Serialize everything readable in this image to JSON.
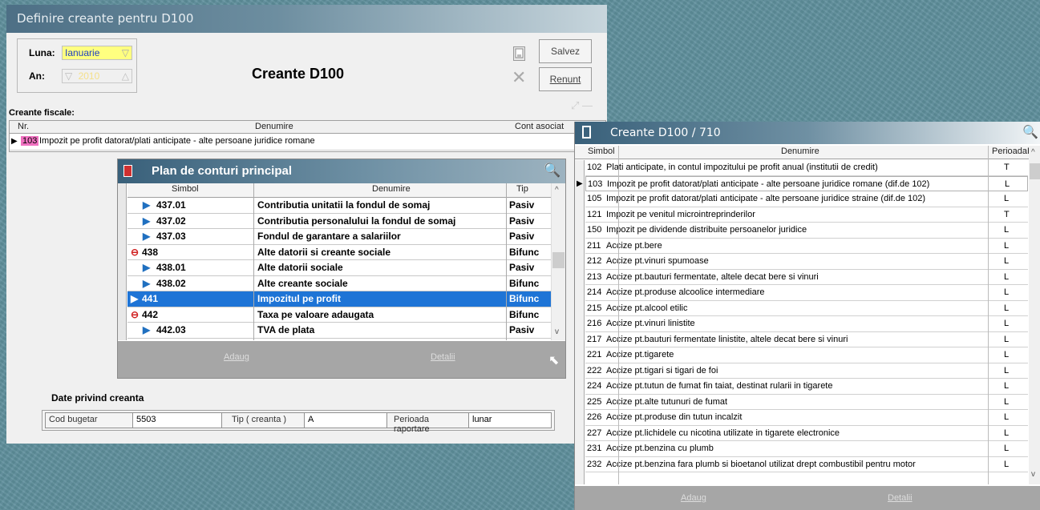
{
  "main_window": {
    "title": "Definire creante pentru D100",
    "luna_label": "Luna:",
    "luna_value": "Ianuarie",
    "an_label": "An:",
    "an_value": "2010",
    "heading": "Creante D100",
    "save_label": "Salvez",
    "cancel_label": "Renunt",
    "creante_label": "Creante fiscale:",
    "columns": {
      "nr": "Nr.",
      "denumire": "Denumire",
      "cont": "Cont asociat"
    },
    "row": {
      "nr": "103",
      "denumire": "Impozit pe profit datorat/plati anticipate - alte persoane juridice romane",
      "cont": ""
    },
    "date_title": "Date privind creanta",
    "cod_label": "Cod bugetar",
    "cod_value": "5503",
    "tip_label": "Tip ( creanta )",
    "tip_value": "A",
    "perioada_label": "Perioada raportare",
    "perioada_value": "lunar"
  },
  "plan": {
    "title": "Plan de conturi principal",
    "columns": {
      "simbol": "Simbol",
      "denumire": "Denumire",
      "tip": "Tip"
    },
    "rows": [
      {
        "simbol": "437.01",
        "denumire": "Contributia unitatii la fondul de somaj",
        "tip": "Pasiv"
      },
      {
        "simbol": "437.02",
        "denumire": "Contributia personalului la fondul de somaj",
        "tip": "Pasiv"
      },
      {
        "simbol": "437.03",
        "denumire": "Fondul de garantare a salariilor",
        "tip": "Pasiv"
      },
      {
        "simbol": "438",
        "denumire": "Alte datorii si creante sociale",
        "tip": "Bifunc"
      },
      {
        "simbol": "438.01",
        "denumire": "Alte datorii sociale",
        "tip": "Pasiv"
      },
      {
        "simbol": "438.02",
        "denumire": "Alte creante sociale",
        "tip": "Bifunc"
      },
      {
        "simbol": "441",
        "denumire": "Impozitul pe profit",
        "tip": "Bifunc"
      },
      {
        "simbol": "442",
        "denumire": "Taxa pe valoare adaugata",
        "tip": "Bifunc"
      },
      {
        "simbol": "442.03",
        "denumire": "TVA de plata",
        "tip": "Pasiv"
      }
    ],
    "add_label": "Adaug",
    "details_label": "Detalii"
  },
  "creante": {
    "title": "Creante D100 / 710",
    "columns": {
      "simbol": "Simbol",
      "denumire": "Denumire",
      "perioada": "PerioadaR"
    },
    "rows": [
      {
        "simbol": "102",
        "denumire": "Plati anticipate, in contul impozitului pe profit anual (institutii de credit)",
        "perioada": "T"
      },
      {
        "simbol": "103",
        "denumire": "Impozit pe profit datorat/plati anticipate - alte persoane juridice romane (dif.de 102)",
        "perioada": "L"
      },
      {
        "simbol": "105",
        "denumire": "Impozit pe profit datorat/plati anticipate - alte persoane juridice straine (dif.de 102)",
        "perioada": "L"
      },
      {
        "simbol": "121",
        "denumire": "Impozit pe venitul microintreprinderilor",
        "perioada": "T"
      },
      {
        "simbol": "150",
        "denumire": "Impozit pe dividende distribuite persoanelor juridice",
        "perioada": "L"
      },
      {
        "simbol": "211",
        "denumire": "Accize pt.bere",
        "perioada": "L"
      },
      {
        "simbol": "212",
        "denumire": "Accize pt.vinuri spumoase",
        "perioada": "L"
      },
      {
        "simbol": "213",
        "denumire": "Accize pt.bauturi fermentate, altele decat bere si vinuri",
        "perioada": "L"
      },
      {
        "simbol": "214",
        "denumire": "Accize pt.produse alcoolice intermediare",
        "perioada": "L"
      },
      {
        "simbol": "215",
        "denumire": "Accize pt.alcool etilic",
        "perioada": "L"
      },
      {
        "simbol": "216",
        "denumire": "Accize pt.vinuri linistite",
        "perioada": "L"
      },
      {
        "simbol": "217",
        "denumire": "Accize pt.bauturi fermentate linistite, altele decat bere si vinuri",
        "perioada": "L"
      },
      {
        "simbol": "221",
        "denumire": "Accize pt.tigarete",
        "perioada": "L"
      },
      {
        "simbol": "222",
        "denumire": "Accize pt.tigari si tigari de foi",
        "perioada": "L"
      },
      {
        "simbol": "224",
        "denumire": "Accize pt.tutun de fumat fin taiat, destinat rularii in tigarete",
        "perioada": "L"
      },
      {
        "simbol": "225",
        "denumire": "Accize pt.alte tutunuri de fumat",
        "perioada": "L"
      },
      {
        "simbol": "226",
        "denumire": "Accize pt.produse din tutun incalzit",
        "perioada": "L"
      },
      {
        "simbol": "227",
        "denumire": "Accize pt.lichidele cu nicotina utilizate in tigarete electronice",
        "perioada": "L"
      },
      {
        "simbol": "231",
        "denumire": "Accize pt.benzina cu plumb",
        "perioada": "L"
      },
      {
        "simbol": "232",
        "denumire": "Accize pt.benzina fara plumb si bioetanol utilizat drept combustibil pentru motor",
        "perioada": "L"
      }
    ],
    "add_label": "Adaug",
    "details_label": "Detalii"
  },
  "colors": {
    "selection": "#1e74d6",
    "highlight": "#ffff80",
    "nr_badge": "#f070c0"
  }
}
